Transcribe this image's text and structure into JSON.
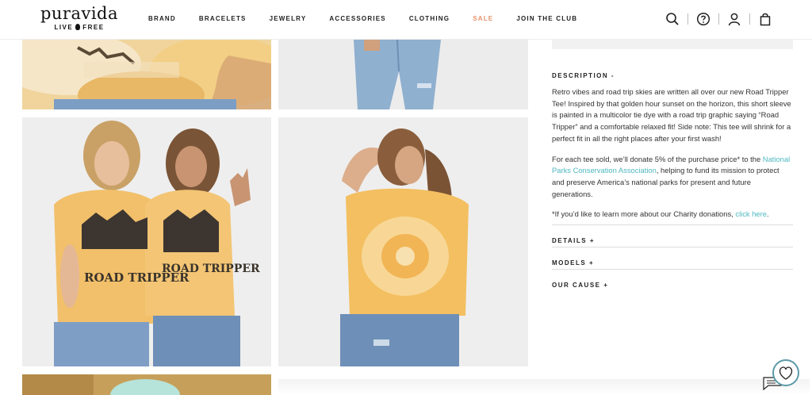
{
  "brand": {
    "name": "puravida",
    "tagline_left": "LIVE",
    "tagline_right": "FREE"
  },
  "nav": {
    "items": [
      {
        "label": "BRAND",
        "id": "brand"
      },
      {
        "label": "BRACELETS",
        "id": "bracelets"
      },
      {
        "label": "JEWELRY",
        "id": "jewelry"
      },
      {
        "label": "ACCESSORIES",
        "id": "accessories"
      },
      {
        "label": "CLOTHING",
        "id": "clothing"
      },
      {
        "label": "SALE",
        "id": "sale"
      },
      {
        "label": "JOIN THE CLUB",
        "id": "join-the-club"
      }
    ]
  },
  "header_icons": [
    "search-icon",
    "help-icon",
    "account-icon",
    "cart-icon"
  ],
  "product_images": [
    {
      "name": "road-tripper-tee-closeup-back",
      "colors": [
        "#e8c27a",
        "#f6e9d4"
      ]
    },
    {
      "name": "jeans-closeup",
      "colors": [
        "#8fb0cf",
        "#ececec"
      ]
    },
    {
      "name": "two-models-front",
      "colors": [
        "#f1b955",
        "#6e8fb7"
      ]
    },
    {
      "name": "model-back-view",
      "colors": [
        "#f3bf60",
        "#6e8fb7"
      ]
    },
    {
      "name": "model-bucket-hat",
      "colors": [
        "#b0e0d6",
        "#c79a4a"
      ]
    }
  ],
  "description": {
    "title": "DESCRIPTION -",
    "paragraph1": "Retro vibes and road trip skies are written all over our new Road Tripper Tee! Inspired by that golden hour sunset on the horizon, this short sleeve is painted in a multicolor tie dye with a road trip graphic saying “Road Tripper” and a comfortable relaxed fit! Side note: This tee will shrink for a perfect fit in all the right places after your first wash!",
    "paragraph2_before": "For each tee sold, we’ll donate 5% of the purchase price* to the ",
    "paragraph2_link": "National Parks Conservation Association",
    "paragraph2_after": ", helping to fund its mission to protect and preserve America’s national parks for present and future generations.",
    "paragraph3_before": "*If you’d like to learn more about our Charity donations, ",
    "paragraph3_link": "click here",
    "paragraph3_after": "."
  },
  "accordions": {
    "details": "DETAILS +",
    "models": "MODELS +",
    "our_cause": "OUR CAUSE +"
  },
  "colors": {
    "accent_link": "#4fb8c0",
    "sale": "#e8946a",
    "chat": "#5b9aa8"
  },
  "chat_icon": "chat-heart-icon"
}
